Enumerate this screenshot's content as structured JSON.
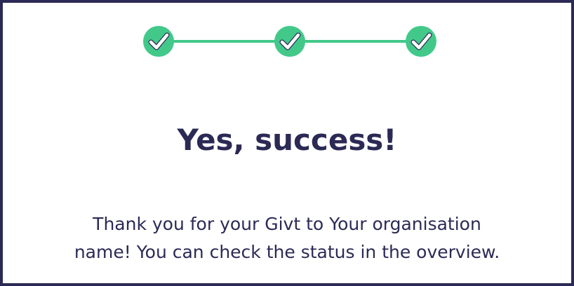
{
  "colors": {
    "accent_green": "#42c98a",
    "text_navy": "#2b2a55",
    "frame_border": "#2b2a55",
    "background": "#ffffff"
  },
  "stepper": {
    "steps": [
      {
        "icon": "check-circle-icon",
        "state": "completed"
      },
      {
        "icon": "check-circle-icon",
        "state": "completed"
      },
      {
        "icon": "check-circle-icon",
        "state": "completed"
      }
    ]
  },
  "success": {
    "title": "Yes, success!",
    "message_line_1": "Thank you for your Givt to Your organisation",
    "message_line_2": "name! You can check the status in the overview."
  }
}
